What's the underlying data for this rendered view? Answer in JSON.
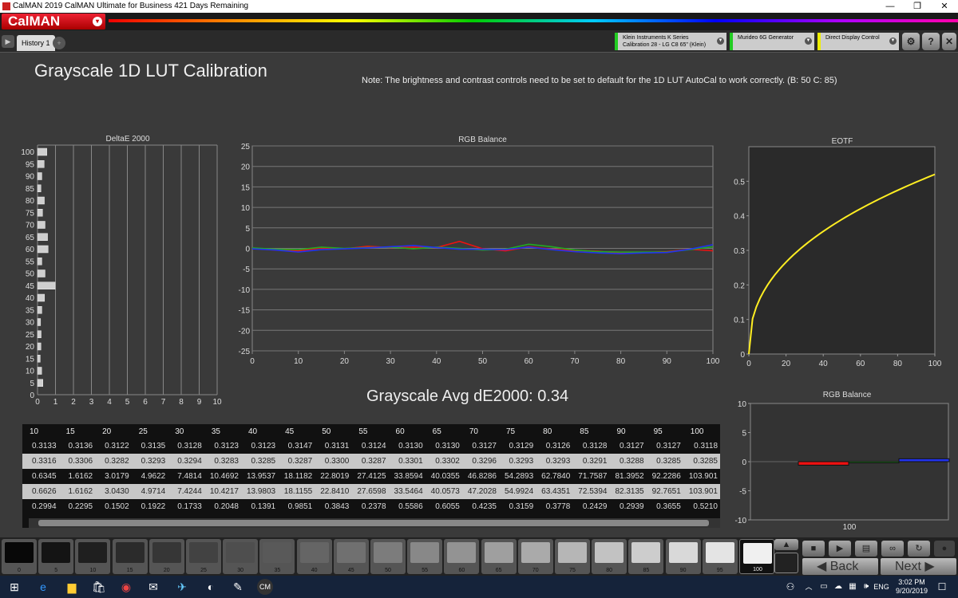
{
  "window": {
    "title": "CalMAN 2019 CalMAN Ultimate for Business 421 Days Remaining",
    "minimize": "—",
    "maximize": "❐",
    "close": "✕"
  },
  "logo": {
    "text": "CalMAN",
    "dropdown": "▾"
  },
  "tabs": {
    "active": "History 1",
    "add": "+",
    "nav": "▶"
  },
  "devices": {
    "meter": {
      "line1": "Klein Instruments K Series",
      "line2": "Calibration 28 - LG C8 65\" (Klein)",
      "color": "#22cc22"
    },
    "generator": {
      "line1": "Murideo 6G Generator",
      "line2": "",
      "color": "#22cc22"
    },
    "display": {
      "line1": "Direct Display Control",
      "line2": "",
      "color": "#eeee00"
    }
  },
  "toolbar_icons": [
    "gear-icon",
    "help-icon",
    "close-icon"
  ],
  "page": {
    "title": "Grayscale  1D LUT Calibration",
    "note": "Note: The brightness and contrast controls need to be set to default for the 1D LUT AutoCal to work correctly.  (B: 50 C: 85)",
    "avg": "Grayscale Avg dE2000: 0.34"
  },
  "chart_data": [
    {
      "type": "bar",
      "title": "DeltaE 2000",
      "orientation": "horizontal",
      "categories": [
        100,
        95,
        90,
        85,
        80,
        75,
        70,
        65,
        60,
        55,
        50,
        45,
        40,
        35,
        30,
        25,
        20,
        15,
        10,
        5,
        0
      ],
      "values": [
        0.52,
        0.37,
        0.24,
        0.19,
        0.38,
        0.28,
        0.42,
        0.56,
        0.59,
        0.24,
        0.42,
        0.98,
        0.39,
        0.24,
        0.17,
        0.2,
        0.19,
        0.15,
        0.23,
        0.3,
        0
      ],
      "xlim": [
        0,
        10
      ],
      "xticks": [
        0,
        1,
        2,
        3,
        4,
        5,
        6,
        7,
        8,
        9,
        10
      ]
    },
    {
      "type": "line",
      "title": "RGB Balance",
      "xlim": [
        0,
        100
      ],
      "ylim": [
        -25,
        25
      ],
      "x": [
        0,
        5,
        10,
        15,
        20,
        25,
        30,
        35,
        40,
        45,
        50,
        55,
        60,
        65,
        70,
        75,
        80,
        85,
        90,
        95,
        100
      ],
      "series": [
        {
          "color": "#ee1111",
          "values": [
            0,
            -0.4,
            -0.6,
            0.1,
            -0.1,
            0.5,
            0.2,
            0.3,
            0.2,
            1.7,
            -0.1,
            -0.6,
            0.4,
            -0.2,
            -0.5,
            -0.7,
            -1.2,
            -1.0,
            -0.8,
            -0.2,
            -0.6
          ]
        },
        {
          "color": "#22aa22",
          "values": [
            0.1,
            -0.2,
            -0.3,
            0.3,
            0.0,
            0.2,
            0.3,
            -0.1,
            0.3,
            0.0,
            -0.4,
            -0.2,
            1.0,
            0.4,
            -0.4,
            -0.8,
            -0.9,
            -0.9,
            -0.9,
            -0.3,
            0.4
          ]
        },
        {
          "color": "#2233ee",
          "values": [
            -0.1,
            -0.4,
            -0.9,
            -0.3,
            -0.1,
            0.1,
            0.4,
            0.7,
            0.2,
            -0.2,
            -0.2,
            -0.3,
            0.3,
            -0.3,
            -0.8,
            -1.1,
            -1.3,
            -1.1,
            -1.0,
            -0.2,
            0.9
          ]
        }
      ],
      "yticks": [
        25,
        20,
        15,
        10,
        5,
        0,
        -5,
        -10,
        -15,
        -20,
        -25
      ],
      "xticks": [
        0,
        10,
        20,
        30,
        40,
        50,
        60,
        70,
        80,
        90,
        100
      ]
    },
    {
      "type": "line",
      "title": "EOTF",
      "xlim": [
        0,
        100
      ],
      "ylim": [
        0,
        0.6
      ],
      "series": [
        {
          "color": "#ffee22",
          "gamma": 2.4,
          "max": 0.52
        }
      ],
      "yticks": [
        0.5,
        0.4,
        0.3,
        0.2,
        0.1,
        0
      ],
      "xticks": [
        0,
        20,
        40,
        60,
        80,
        100
      ]
    },
    {
      "type": "bar",
      "title": "RGB Balance",
      "category": "100",
      "ylim": [
        -10,
        10
      ],
      "bars": [
        {
          "color": "#ee1111",
          "value": -0.6
        },
        {
          "color": "#22aa22",
          "value": -0.1
        },
        {
          "color": "#2233ee",
          "value": 0.5
        }
      ],
      "yticks": [
        10,
        5,
        0,
        -5,
        -10
      ]
    }
  ],
  "table": {
    "headers": [
      "10",
      "15",
      "20",
      "25",
      "30",
      "35",
      "40",
      "45",
      "50",
      "55",
      "60",
      "65",
      "70",
      "75",
      "80",
      "85",
      "90",
      "95",
      "100"
    ],
    "rows": [
      [
        "0.3133",
        "0.3136",
        "0.3122",
        "0.3135",
        "0.3128",
        "0.3123",
        "0.3123",
        "0.3147",
        "0.3131",
        "0.3124",
        "0.3130",
        "0.3130",
        "0.3127",
        "0.3129",
        "0.3126",
        "0.3128",
        "0.3127",
        "0.3127",
        "0.3118"
      ],
      [
        "0.3316",
        "0.3306",
        "0.3282",
        "0.3293",
        "0.3294",
        "0.3283",
        "0.3285",
        "0.3287",
        "0.3300",
        "0.3287",
        "0.3301",
        "0.3302",
        "0.3296",
        "0.3293",
        "0.3293",
        "0.3291",
        "0.3288",
        "0.3285",
        "0.3285"
      ],
      [
        "0.6345",
        "1.6162",
        "3.0179",
        "4.9622",
        "7.4814",
        "10.4692",
        "13.9537",
        "18.1182",
        "22.8019",
        "27.4125",
        "33.8594",
        "40.0355",
        "46.8286",
        "54.2893",
        "62.7840",
        "71.7587",
        "81.3952",
        "92.2286",
        "103.901"
      ],
      [
        "0.6626",
        "1.6162",
        "3.0430",
        "4.9714",
        "7.4244",
        "10.4217",
        "13.9803",
        "18.1155",
        "22.8410",
        "27.6598",
        "33.5464",
        "40.0573",
        "47.2028",
        "54.9924",
        "63.4351",
        "72.5394",
        "82.3135",
        "92.7651",
        "103.901"
      ],
      [
        "0.2994",
        "0.2295",
        "0.1502",
        "0.1922",
        "0.1733",
        "0.2048",
        "0.1391",
        "0.9851",
        "0.3843",
        "0.2378",
        "0.5586",
        "0.6055",
        "0.4235",
        "0.3159",
        "0.3778",
        "0.2429",
        "0.2939",
        "0.3655",
        "0.5210"
      ]
    ]
  },
  "swatches": [
    "0",
    "5",
    "10",
    "15",
    "20",
    "25",
    "30",
    "35",
    "40",
    "45",
    "50",
    "55",
    "60",
    "65",
    "70",
    "75",
    "80",
    "85",
    "90",
    "95",
    "100"
  ],
  "nav": {
    "back": "Back",
    "next": "Next"
  },
  "tray": {
    "lang": "ENG",
    "time": "3:02 PM",
    "date": "9/20/2019"
  }
}
